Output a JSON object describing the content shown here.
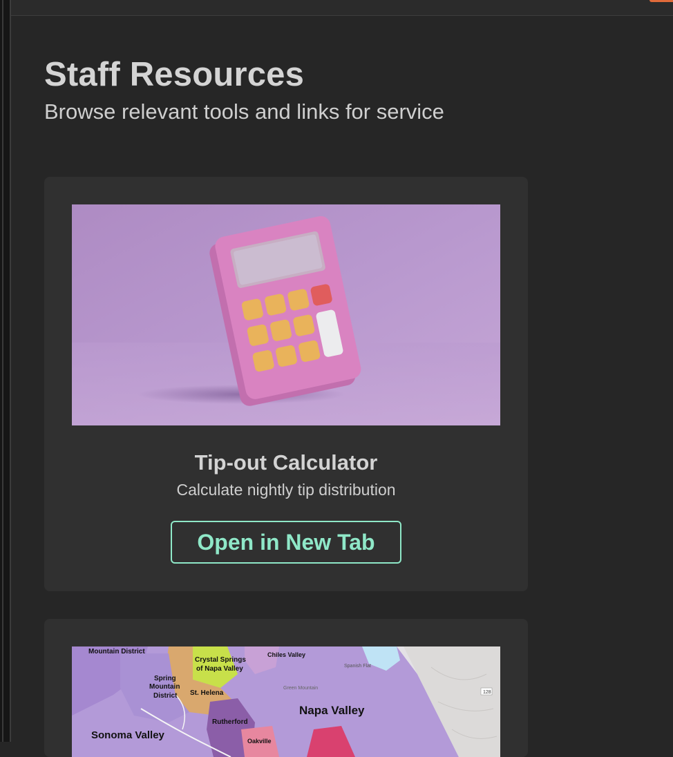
{
  "page": {
    "title": "Staff Resources",
    "subtitle": "Browse relevant tools and links for service"
  },
  "resources": [
    {
      "title": "Tip-out Calculator",
      "description": "Calculate nightly tip distribution",
      "button_label": "Open in New Tab",
      "image_icon": "calculator-illustration"
    },
    {
      "image_icon": "napa-valley-map",
      "map_labels": {
        "mountain_district": "Mountain District",
        "chiles_valley": "Chiles Valley",
        "crystal_springs_1": "Crystal Springs",
        "crystal_springs_2": "of Napa Valley",
        "spring_mountain_1": "Spring",
        "spring_mountain_2": "Mountain",
        "spring_mountain_3": "District",
        "st_helena": "St. Helena",
        "napa_valley": "Napa Valley",
        "rutherford": "Rutherford",
        "sonoma_valley": "Sonoma Valley",
        "oakville": "Oakville",
        "spanish_flat": "Spanish Flat",
        "green_mountain": "Green Mountain",
        "route": "128"
      }
    }
  ],
  "colors": {
    "background": "#262626",
    "card": "#303030",
    "accent": "#8fe8c8",
    "title": "#d4d4d4"
  }
}
